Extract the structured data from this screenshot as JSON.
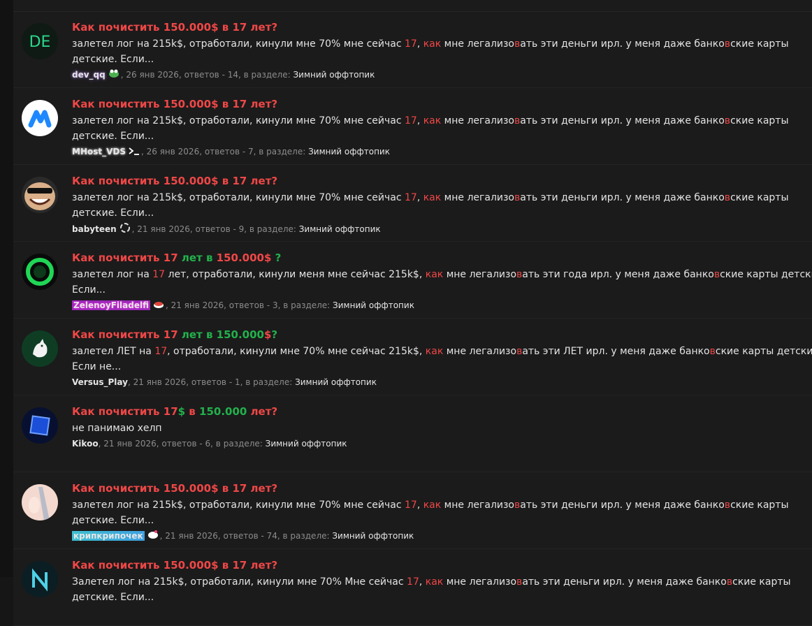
{
  "colors": {
    "title_red": "#f04747",
    "title_green": "#22b14c",
    "meta_gray": "#8c8c8c"
  },
  "posts": [
    {
      "avatar": "DE-text-avatar",
      "title": [
        {
          "t": "Как почистить 150.000$ в 17 лет?",
          "c": "r"
        }
      ],
      "snippet": [
        {
          "t": "залетел лог на 215k$, отработали, кинули мне 70% мне сейчас "
        },
        {
          "t": "17",
          "c": "r"
        },
        {
          "t": ", "
        },
        {
          "t": "как",
          "c": "r"
        },
        {
          "t": " мне легализо"
        },
        {
          "t": "в",
          "c": "r"
        },
        {
          "t": "ать эти деньги ирл. у меня даже банко"
        },
        {
          "t": "в",
          "c": "r"
        },
        {
          "t": "ские карты детские. Если..."
        }
      ],
      "user": "dev_qq",
      "user_class": "u-dev",
      "badge": "frog-icon",
      "meta_rest": ", 26 янв 2026, ответов - 14, в разделе: ",
      "section": "Зимний оффтопик"
    },
    {
      "avatar": "M-logo-avatar",
      "title": [
        {
          "t": "Как почистить 150.000$ в 17 лет?",
          "c": "r"
        }
      ],
      "snippet": [
        {
          "t": "залетел лог на 215k$, отработали, кинули мне 70% мне сейчас "
        },
        {
          "t": "17",
          "c": "r"
        },
        {
          "t": ", "
        },
        {
          "t": "как",
          "c": "r"
        },
        {
          "t": " мне легализо"
        },
        {
          "t": "в",
          "c": "r"
        },
        {
          "t": "ать эти деньги ирл. у меня даже банко"
        },
        {
          "t": "в",
          "c": "r"
        },
        {
          "t": "ские карты детские. Если..."
        }
      ],
      "user": "MHost_VDS",
      "user_class": "u-mhost",
      "badge": "terminal-icon",
      "meta_rest": ", 26 янв 2026, ответов - 7, в разделе: ",
      "section": "Зимний оффтопик"
    },
    {
      "avatar": "trollface-avatar",
      "title": [
        {
          "t": "Как почистить 150.000$ в 17 лет?",
          "c": "r"
        }
      ],
      "snippet": [
        {
          "t": "залетел лог на 215k$, отработали, кинули мне 70% мне сейчас "
        },
        {
          "t": "17",
          "c": "r"
        },
        {
          "t": ", "
        },
        {
          "t": "как",
          "c": "r"
        },
        {
          "t": " мне легализо"
        },
        {
          "t": "в",
          "c": "r"
        },
        {
          "t": "ать эти деньги ирл. у меня даже банко"
        },
        {
          "t": "в",
          "c": "r"
        },
        {
          "t": "ские карты детские. Если..."
        }
      ],
      "user": "babyteen",
      "user_class": "",
      "badge": "link-icon",
      "meta_rest": ", 21 янв 2026, ответов - 9, в разделе: ",
      "section": "Зимний оффтопик"
    },
    {
      "avatar": "green-ring-avatar",
      "title": [
        {
          "t": "Как почистить ",
          "c": "r"
        },
        {
          "t": "17",
          "c": "r"
        },
        {
          "t": " лет в ",
          "c": "g"
        },
        {
          "t": "150.000$",
          "c": "r"
        },
        {
          "t": " ?",
          "c": "g"
        }
      ],
      "snippet": [
        {
          "t": "залетел лог на "
        },
        {
          "t": "17",
          "c": "r"
        },
        {
          "t": " лет, отработали, кинули меня мне сейчас 215k$, "
        },
        {
          "t": "как",
          "c": "r"
        },
        {
          "t": " мне легализо"
        },
        {
          "t": "в",
          "c": "r"
        },
        {
          "t": "ать эти года ирл. у меня даже банко"
        },
        {
          "t": "в",
          "c": "r"
        },
        {
          "t": "ские карты детские. Если..."
        }
      ],
      "user": "ZelenoyFiladelfi",
      "user_class": "u-zel",
      "badge": "sushi-icon",
      "meta_rest": ", 21 янв 2026, ответов - 3, в разделе: ",
      "section": "Зимний оффтопик"
    },
    {
      "avatar": "green-rooster-avatar",
      "title": [
        {
          "t": "Как почистить ",
          "c": "r"
        },
        {
          "t": "17",
          "c": "r"
        },
        {
          "t": " лет в 150.000",
          "c": "g"
        },
        {
          "t": "$",
          "c": "r"
        },
        {
          "t": "?",
          "c": "g"
        }
      ],
      "snippet": [
        {
          "t": "залетел ЛЕТ на "
        },
        {
          "t": "17",
          "c": "r"
        },
        {
          "t": ", отработали, кинули мне 70% мне сейчас 215k$, "
        },
        {
          "t": "как",
          "c": "r"
        },
        {
          "t": " мне легализо"
        },
        {
          "t": "в",
          "c": "r"
        },
        {
          "t": "ать эти ЛЕТ ирл. у меня даже банко"
        },
        {
          "t": "в",
          "c": "r"
        },
        {
          "t": "ские карты детские. Если не..."
        }
      ],
      "user": "Versus_Play",
      "user_class": "",
      "badge": "",
      "meta_rest": ", 21 янв 2026, ответов - 1, в разделе: ",
      "section": "Зимний оффтопик"
    },
    {
      "avatar": "blue-cube-avatar",
      "title": [
        {
          "t": "Как почистить 17",
          "c": "r"
        },
        {
          "t": "$",
          "c": "g"
        },
        {
          "t": " в ",
          "c": "r"
        },
        {
          "t": "150.000",
          "c": "g"
        },
        {
          "t": " лет?",
          "c": "r"
        }
      ],
      "snippet": [
        {
          "t": "не панимаю хелп"
        }
      ],
      "user": "Kikoo",
      "user_class": "u-kikoo",
      "badge": "",
      "meta_rest": ", 21 янв 2026, ответов - 6, в разделе: ",
      "section": "Зимний оффтопик"
    },
    {
      "avatar": "anime-avatar",
      "title": [
        {
          "t": "Как почистить 150.000$ в 17 лет?",
          "c": "r"
        }
      ],
      "snippet": [
        {
          "t": "залетел лог на 215k$, отработали, кинули мне 70% мне сейчас "
        },
        {
          "t": "17",
          "c": "r"
        },
        {
          "t": ", "
        },
        {
          "t": "как",
          "c": "r"
        },
        {
          "t": " мне легализо"
        },
        {
          "t": "в",
          "c": "r"
        },
        {
          "t": "ать эти деньги ирл. у меня даже банко"
        },
        {
          "t": "в",
          "c": "r"
        },
        {
          "t": "ские карты детские. Если..."
        }
      ],
      "user": "крипкрипочек",
      "user_class": "u-krip",
      "badge": "hello-kitty-icon",
      "meta_rest": ", 21 янв 2026, ответов - 74, в разделе: ",
      "section": "Зимний оффтопик"
    },
    {
      "avatar": "N-logo-avatar",
      "title": [
        {
          "t": "Как почистить 150.000$ в 17 лет?",
          "c": "r"
        }
      ],
      "snippet": [
        {
          "t": "Залетел лог на 215k$, отработали, кинули мне 70% Мне сейчас "
        },
        {
          "t": "17",
          "c": "r"
        },
        {
          "t": ", "
        },
        {
          "t": "как",
          "c": "r"
        },
        {
          "t": " мне легализо"
        },
        {
          "t": "в",
          "c": "r"
        },
        {
          "t": "ать эти деньги ирл. у меня даже банко"
        },
        {
          "t": "в",
          "c": "r"
        },
        {
          "t": "ские карты детские. Если..."
        }
      ],
      "user": "",
      "user_class": "",
      "badge": "",
      "meta_rest": "",
      "section": ""
    }
  ]
}
